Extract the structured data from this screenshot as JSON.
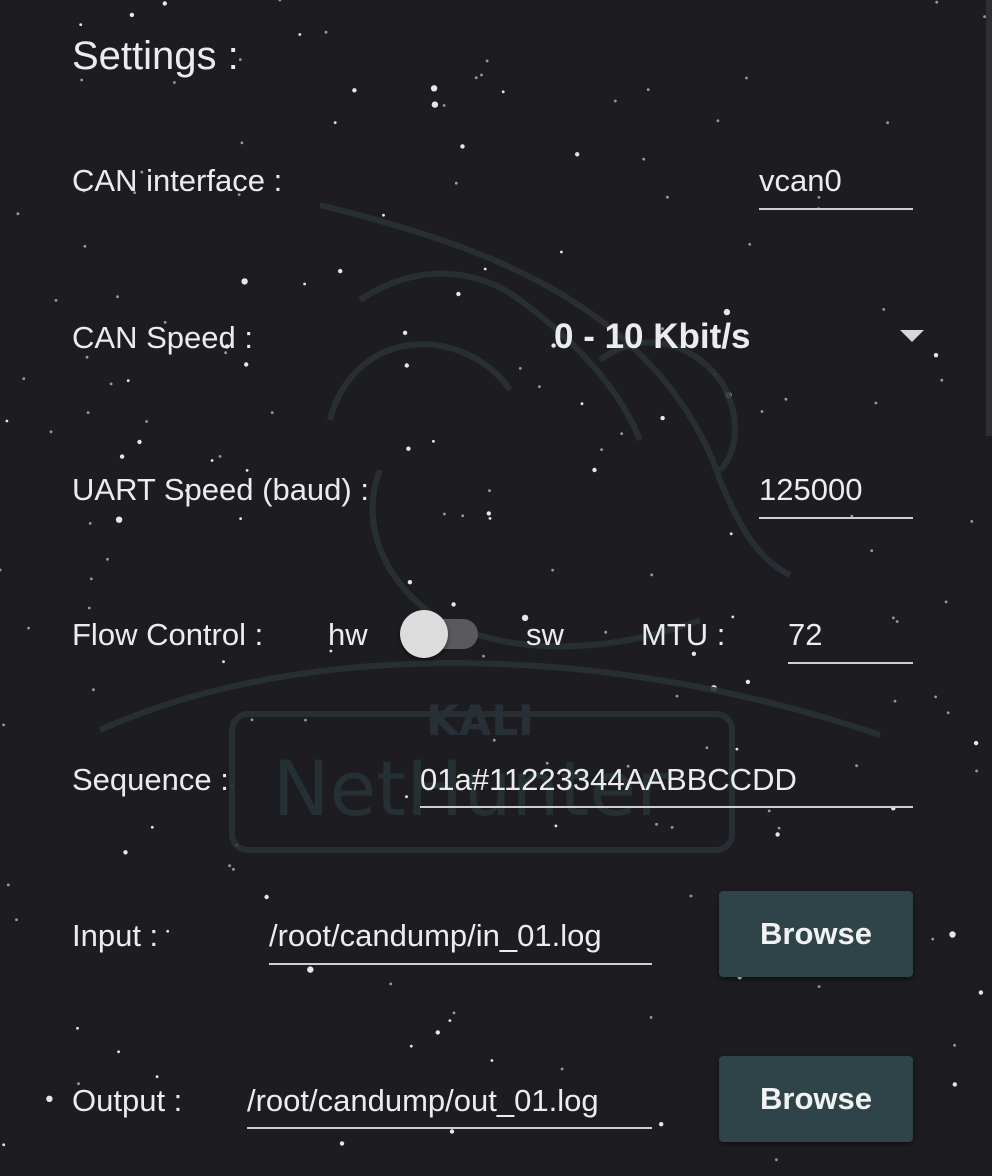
{
  "title": "Settings :",
  "can_interface": {
    "label": "CAN interface :",
    "value": "vcan0"
  },
  "can_speed": {
    "label": "CAN Speed :",
    "selected": "0 - 10 Kbit/s"
  },
  "uart_speed": {
    "label": "UART Speed (baud) :",
    "value": "125000"
  },
  "flow_control": {
    "label": "Flow Control :",
    "off_label": "hw",
    "on_label": "sw",
    "switch_on": false,
    "mtu_label": "MTU :",
    "mtu_value": "72"
  },
  "sequence": {
    "label": "Sequence :",
    "value": "01a#11223344AABBCCDD"
  },
  "input": {
    "label": "Input :",
    "value": "/root/candump/in_01.log",
    "button": "Browse"
  },
  "output": {
    "label": "Output :",
    "value": "/root/candump/out_01.log",
    "button": "Browse"
  },
  "colors": {
    "background": "#1d1c20",
    "button": "#2f4449",
    "text": "#ececec",
    "underline": "#cfcfcf"
  },
  "icons": [
    "dropdown-arrow-icon",
    "kali-dragon-watermark-icon"
  ]
}
